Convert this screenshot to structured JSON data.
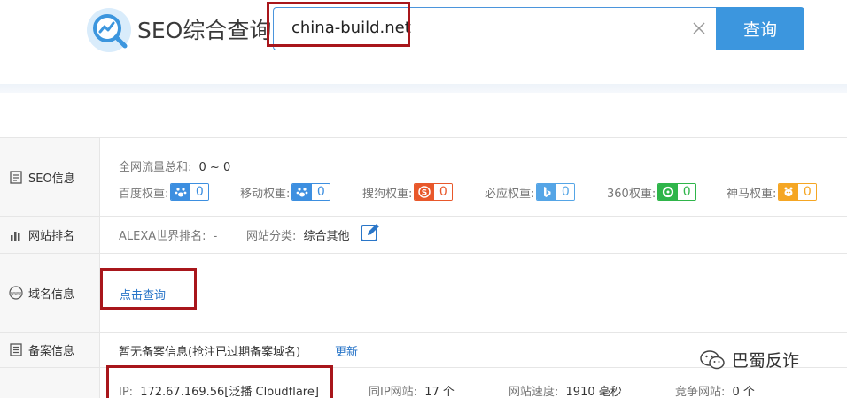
{
  "header": {
    "title": "SEO综合查询",
    "search_value": "china-build.net",
    "search_button": "查询"
  },
  "rows": {
    "seo": {
      "label": "SEO信息",
      "traffic_label": "全网流量总和:",
      "traffic_value": "0 ~ 0",
      "weights": [
        {
          "label": "百度权重:",
          "value": "0",
          "icon": "baidu-paw-icon",
          "color": "#3d8fe0"
        },
        {
          "label": "移动权重:",
          "value": "0",
          "icon": "baidu-paw-icon",
          "color": "#3d8fe0"
        },
        {
          "label": "搜狗权重:",
          "value": "0",
          "icon": "sogou-icon",
          "color": "#e8582b"
        },
        {
          "label": "必应权重:",
          "value": "0",
          "icon": "bing-icon",
          "color": "#55a5e6"
        },
        {
          "label": "360权重:",
          "value": "0",
          "icon": "360-icon",
          "color": "#2fb54a"
        },
        {
          "label": "神马权重:",
          "value": "0",
          "icon": "shenma-icon",
          "color": "#f5a623"
        }
      ]
    },
    "rank": {
      "label": "网站排名",
      "alexa_label": "ALEXA世界排名:",
      "alexa_value": "-",
      "category_label": "网站分类:",
      "category_value": "综合其他"
    },
    "domain": {
      "label": "域名信息",
      "query_link": "点击查询"
    },
    "icp": {
      "label": "备案信息",
      "text": "暂无备案信息(抢注已过期备案域名)",
      "update_link": "更新"
    },
    "ip": {
      "ip_label": "IP:",
      "ip_value": "172.67.169.56[泛播 Cloudflare]",
      "same_ip_label": "同IP网站:",
      "same_ip_value": "17 个",
      "speed_label": "网站速度:",
      "speed_value": "1910 毫秒",
      "competitor_label": "竞争网站:",
      "competitor_value": "0 个"
    }
  },
  "watermark": {
    "text": "巴蜀反诈"
  }
}
